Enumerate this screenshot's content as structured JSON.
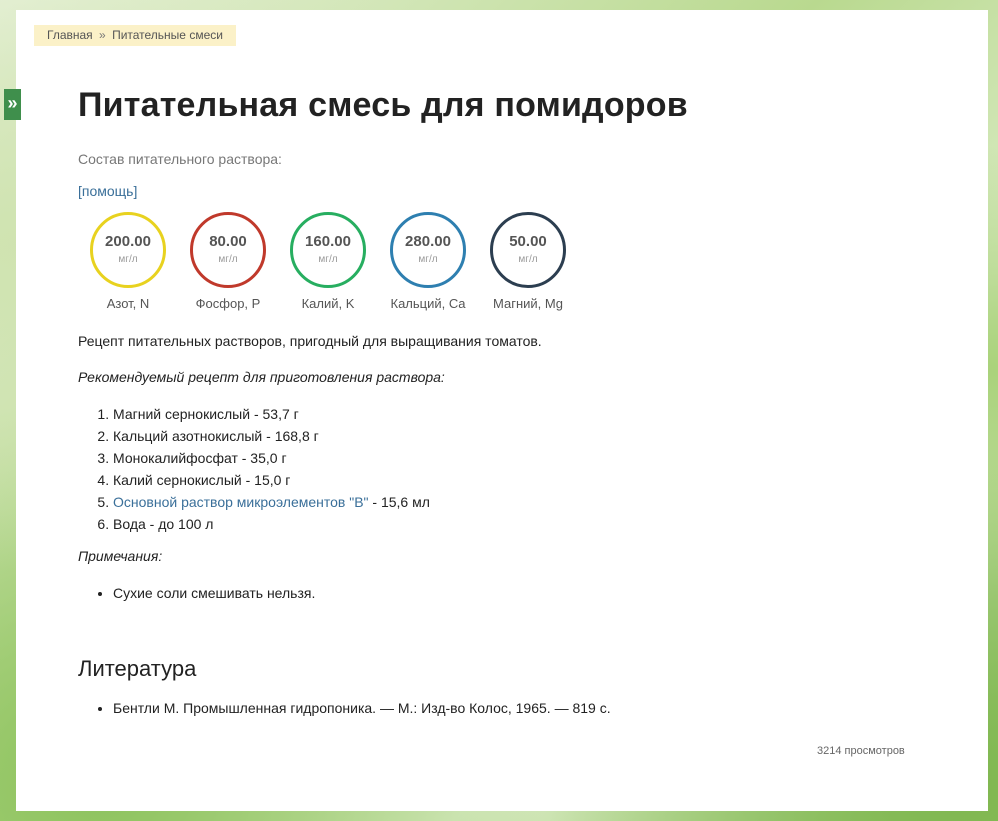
{
  "sidebar_toggle": {
    "label": "»"
  },
  "breadcrumb": {
    "home": "Главная",
    "separator": "»",
    "current": "Питательные смеси"
  },
  "page": {
    "title": "Питательная смесь для помидоров",
    "composition_label": "Состав питательного раствора:",
    "help_link": "[помощь]"
  },
  "nutrients": [
    {
      "value": "200.00",
      "unit": "мг/л",
      "name": "Азот, N",
      "color": "#e8d21f"
    },
    {
      "value": "80.00",
      "unit": "мг/л",
      "name": "Фосфор, P",
      "color": "#c0392b"
    },
    {
      "value": "160.00",
      "unit": "мг/л",
      "name": "Калий, K",
      "color": "#27ae60"
    },
    {
      "value": "280.00",
      "unit": "мг/л",
      "name": "Кальций, Ca",
      "color": "#2e7fb0"
    },
    {
      "value": "50.00",
      "unit": "мг/л",
      "name": "Магний, Mg",
      "color": "#2c3e50"
    }
  ],
  "description": "Рецепт питательных растворов, пригодный для выращивания томатов.",
  "recipe": {
    "title": "Рекомендуемый рецепт для приготовления раствора:",
    "items": [
      {
        "text": "Магний сернокислый - 53,7 г"
      },
      {
        "text": "Кальций азотнокислый - 168,8 г"
      },
      {
        "text": "Монокалийфосфат - 35,0 г"
      },
      {
        "text": "Калий сернокислый - 15,0 г"
      },
      {
        "link": "Основной раствор микроэлементов \"В\"",
        "text": " - 15,6 мл"
      },
      {
        "text": "Вода - до 100 л"
      }
    ]
  },
  "notes": {
    "title": "Примечания:",
    "items": [
      "Сухие соли смешивать нельзя."
    ]
  },
  "literature": {
    "title": "Литература",
    "items": [
      "Бентли М. Промышленная гидропоника. — М.: Изд-во Колос, 1965. — 819 с."
    ]
  },
  "views": "3214 просмотров"
}
